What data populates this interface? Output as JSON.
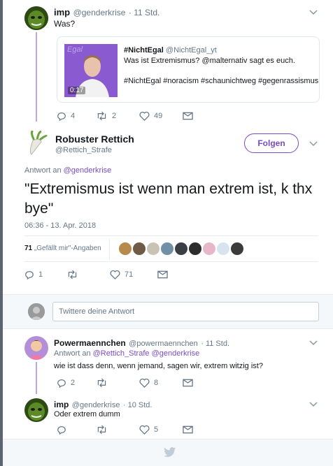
{
  "tweets": [
    {
      "name": "imp",
      "handle": "@genderkrise",
      "time": "· 11 Std.",
      "text": "Was?",
      "actions": {
        "replies": "4",
        "retweets": "2",
        "likes": "49"
      }
    }
  ],
  "quote": {
    "name": "#NichtEgal",
    "handle": "@NichtEgal_yt",
    "line1": "Was ist Extremismus? @malternativ sagt es euch.",
    "line2": "#NichtEgal #noracism #schaunichtweg #gegenrassismus",
    "duration": "0:17",
    "thumb_watermark": "Egal"
  },
  "main": {
    "name": "Robuster Rettich",
    "handle": "@Rettich_Strafe",
    "follow_label": "Folgen",
    "reply_to_prefix": "Antwort an ",
    "reply_to_handle": "@genderkrise",
    "text": "\"Extremismus ist wenn man extrem ist, k thx bye\"",
    "timestamp": "06:36 - 13. Apr. 2018",
    "likes_count": "71",
    "likes_label": "„Gefällt mir\"-Angaben",
    "actions": {
      "replies": "1",
      "retweets": "",
      "likes": "71"
    }
  },
  "reply_box": {
    "placeholder": "Twittere deine Antwort"
  },
  "replies": [
    {
      "name": "Powermaennchen",
      "handle": "@powermaennchen",
      "time": "· 11 Std.",
      "reply_to_prefix": "Antwort an ",
      "reply_to_handles": "@Rettich_Strafe @genderkrise",
      "text": "wie ist dass denn, wenn jemand, sagen wir, extrem witzig ist?",
      "actions": {
        "replies": "2",
        "retweets": "",
        "likes": "8"
      }
    },
    {
      "name": "imp",
      "handle": "@genderkrise",
      "time": "· 10 Std.",
      "text": "Oder extrem dumm",
      "actions": {
        "replies": "",
        "retweets": "",
        "likes": "5"
      }
    }
  ],
  "icons": {
    "reply": "reply-icon",
    "retweet": "retweet-icon",
    "like": "heart-icon",
    "dm": "envelope-icon",
    "caret": "chevron-down-icon",
    "footer": "twitter-bird-icon"
  },
  "colors": {
    "accent": "#794bc4",
    "thread_line": "#c1a4e3",
    "text": "#14171a",
    "muted": "#657786"
  }
}
